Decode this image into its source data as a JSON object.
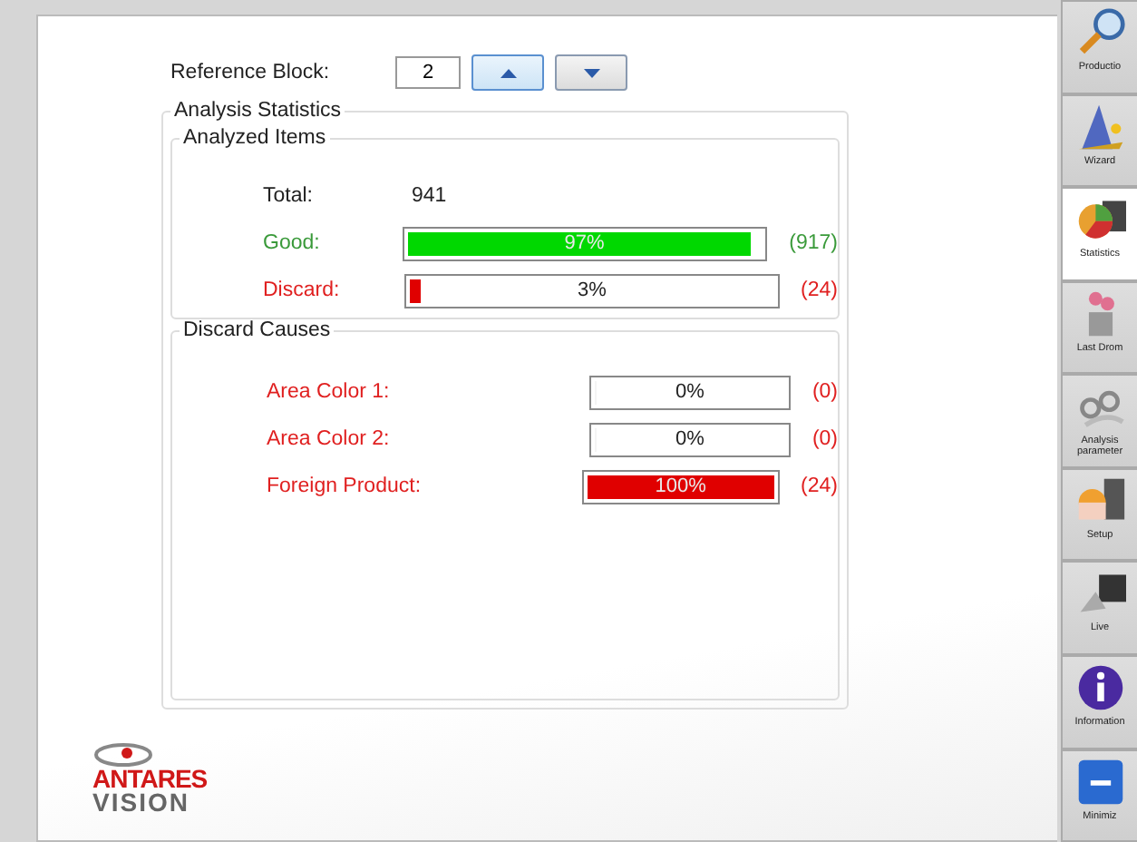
{
  "reference_block": {
    "label": "Reference Block:",
    "value": "2"
  },
  "analysis_statistics": {
    "title": "Analysis Statistics",
    "analyzed_items": {
      "title": "Analyzed Items",
      "total_label": "Total:",
      "total_value": "941",
      "rows": [
        {
          "label": "Good:",
          "kind": "good",
          "level": 0.97,
          "percent": "97%",
          "count": "(917)"
        },
        {
          "label": "Discard:",
          "kind": "bad",
          "level": 0.03,
          "percent": "3%",
          "count": "(24)"
        }
      ]
    },
    "discard_causes": {
      "title": "Discard Causes",
      "rows": [
        {
          "label": "Area Color 1:",
          "kind": "bad",
          "level": 0,
          "percent": "0%",
          "count": "(0)"
        },
        {
          "label": "Area Color 2:",
          "kind": "bad",
          "level": 0,
          "percent": "0%",
          "count": "(0)"
        },
        {
          "label": "Foreign Product:",
          "kind": "bad",
          "level": 1,
          "percent": "100%",
          "count": "(24)"
        }
      ]
    }
  },
  "logo": {
    "top": "ANTARES",
    "bottom": "VISION"
  },
  "sidebar": {
    "items": [
      {
        "label": "Productio",
        "selected": false
      },
      {
        "label": "Wizard",
        "selected": false
      },
      {
        "label": "Statistics",
        "selected": true
      },
      {
        "label": "Last Drom",
        "selected": false
      },
      {
        "label": "Analysis parameter",
        "selected": false
      },
      {
        "label": "Setup",
        "selected": false
      },
      {
        "label": "Live",
        "selected": false
      },
      {
        "label": "Information",
        "selected": false
      },
      {
        "label": "Minimiz",
        "selected": false
      }
    ]
  }
}
